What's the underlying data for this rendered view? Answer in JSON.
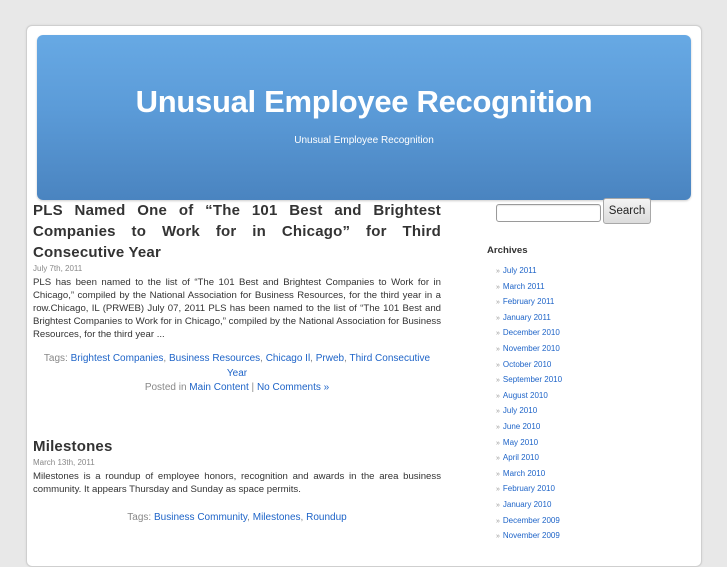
{
  "header": {
    "title": "Unusual Employee Recognition",
    "description": "Unusual Employee Recognition"
  },
  "posts": [
    {
      "title": "PLS Named One of “The 101 Best and Brightest Companies to Work for in Chicago” for Third Consecutive Year",
      "date": "July 7th, 2011",
      "excerpt": "PLS has been named to the list of “The 101 Best and Brightest Companies to Work for in Chicago,” compiled by the National Association for Business Resources, for the third year in a row.Chicago, IL (PRWEB) July 07, 2011 PLS has been named to the list of “The 101 Best and Brightest Companies to Work for in Chicago,” compiled by the National Association for Business Resources, for the third year ...",
      "tags_label": "Tags: ",
      "tags": [
        "Brightest Companies",
        "Business Resources",
        "Chicago Il",
        "Prweb",
        "Third Consecutive Year"
      ],
      "posted_in_label": "Posted in ",
      "category": "Main Content",
      "separator": " | ",
      "comments": "No Comments »"
    },
    {
      "title": "Milestones",
      "date": "March 13th, 2011",
      "excerpt": "Milestones is a roundup of employee honors, recognition and awards in the area business community. It appears Thursday and Sunday as space permits.",
      "tags_label": "Tags: ",
      "tags": [
        "Business Community",
        "Milestones",
        "Roundup"
      ]
    }
  ],
  "sidebar": {
    "search": {
      "value": "",
      "placeholder": "",
      "button_label": "Search"
    },
    "archives": {
      "title": "Archives",
      "bullet": "»",
      "items": [
        "July 2011",
        "March 2011",
        "February 2011",
        "January 2011",
        "December 2010",
        "November 2010",
        "October 2010",
        "September 2010",
        "August 2010",
        "July 2010",
        "June 2010",
        "May 2010",
        "April 2010",
        "March 2010",
        "February 2010",
        "January 2010",
        "December 2009",
        "November 2009"
      ]
    }
  },
  "colors": {
    "link": "#1e64c8",
    "header_top": "#67a9e4",
    "header_bottom": "#4a84c0",
    "background": "#e8e8e8"
  }
}
